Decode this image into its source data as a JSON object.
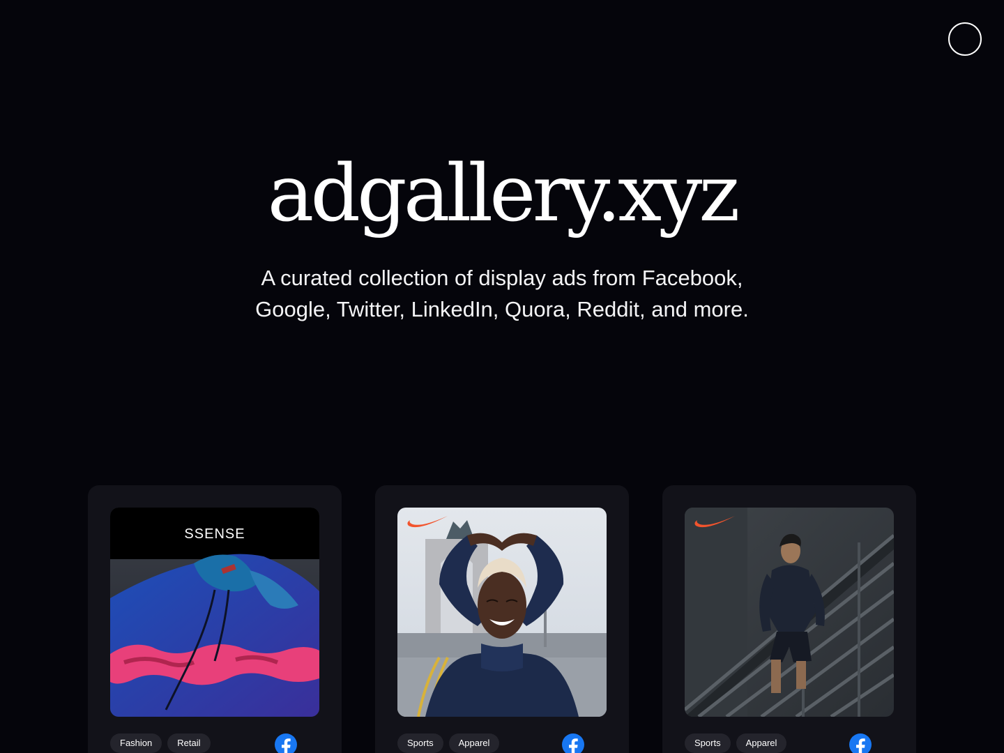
{
  "header": {
    "menu_icon": "circle-outline-icon"
  },
  "hero": {
    "title": "adgallery.xyz",
    "subtitle": "A curated collection of display ads from Facebook, Google, Twitter, LinkedIn, Quora, Reddit, and more."
  },
  "cards": [
    {
      "brand_text": "SSENSE",
      "tags": [
        "Fashion",
        "Retail"
      ],
      "platform_icon": "facebook-icon"
    },
    {
      "tags": [
        "Sports",
        "Apparel"
      ],
      "platform_icon": "facebook-icon"
    },
    {
      "tags": [
        "Sports",
        "Apparel"
      ],
      "platform_icon": "facebook-icon"
    }
  ],
  "colors": {
    "background": "#05050b",
    "card": "#121219",
    "tag": "#24242c",
    "facebook_blue": "#1877f2",
    "nike_orange": "#f2542d"
  }
}
